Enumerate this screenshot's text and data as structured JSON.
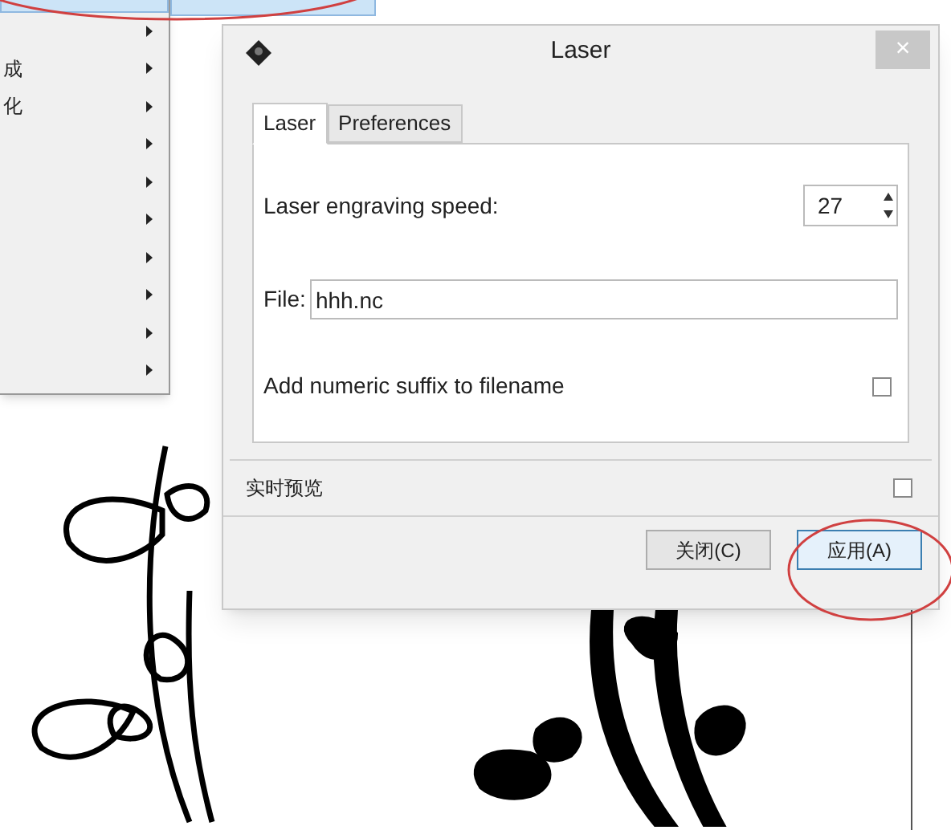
{
  "menu": {
    "items": [
      {
        "kind": "blank",
        "selected": true
      },
      {
        "kind": "blank",
        "selected": false
      },
      {
        "kind": "text",
        "label": "成",
        "selected": false
      },
      {
        "kind": "text",
        "label": "化",
        "selected": false
      },
      {
        "kind": "blank",
        "selected": false
      },
      {
        "kind": "blank",
        "selected": false
      },
      {
        "kind": "blank",
        "selected": false
      },
      {
        "kind": "blank",
        "selected": false
      },
      {
        "kind": "blank",
        "selected": false
      },
      {
        "kind": "blank",
        "selected": false
      },
      {
        "kind": "blank",
        "selected": false
      }
    ],
    "submenu": {
      "selected": true
    }
  },
  "dialog": {
    "title": "Laser",
    "close_glyph": "×",
    "tabs": [
      {
        "label": "Laser",
        "selected": true
      },
      {
        "label": "Preferences",
        "selected": false
      }
    ],
    "speed": {
      "label": "Laser engraving speed:",
      "value": "27"
    },
    "file": {
      "label": "File:",
      "value": "hhh.nc"
    },
    "suffix": {
      "label": "Add numeric suffix to filename",
      "checked": false
    },
    "preview": {
      "label": "实时预览",
      "checked": false
    },
    "buttons": [
      {
        "label": "关闭(C)",
        "kind": "close"
      },
      {
        "label": "应用(A)",
        "kind": "apply"
      }
    ]
  }
}
